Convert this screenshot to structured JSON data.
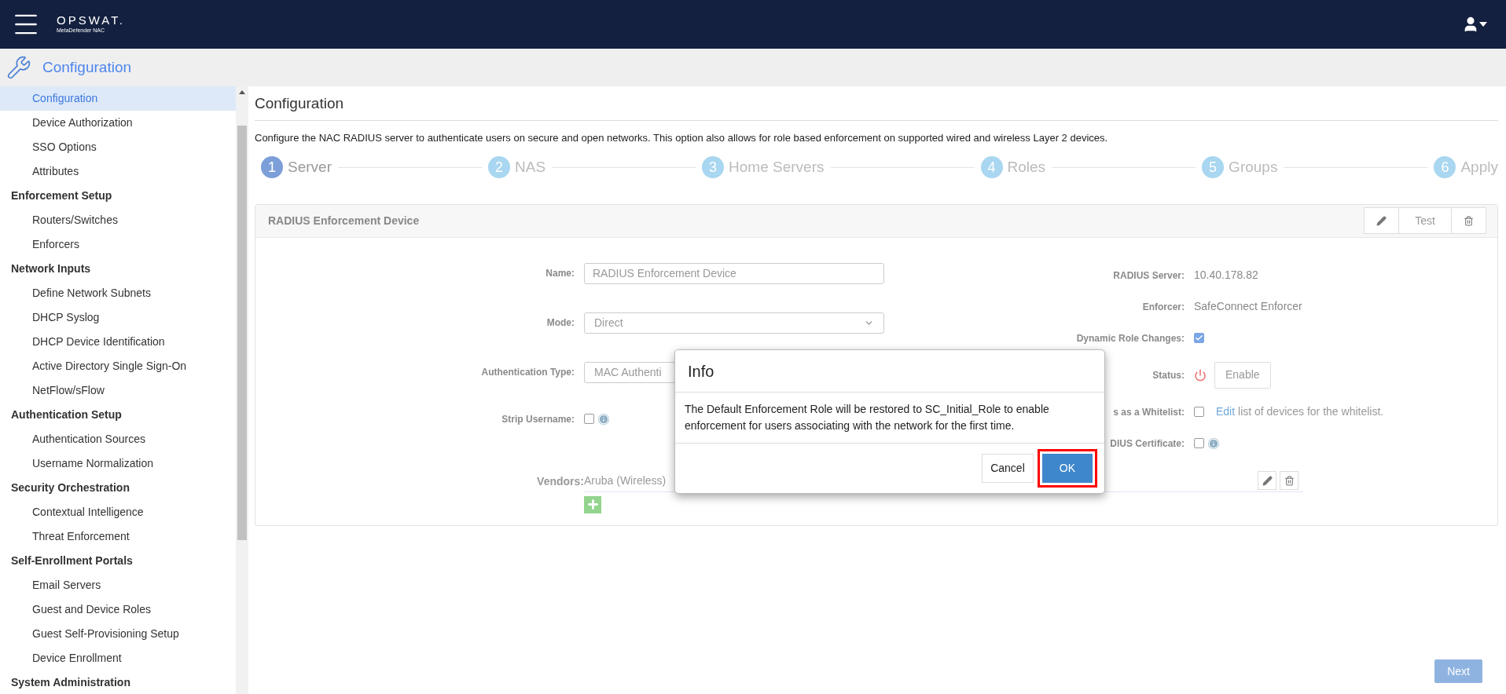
{
  "header": {
    "brand": "OPSWAT.",
    "product": "MetaDefender NAC"
  },
  "section_title": "Configuration",
  "sidebar": {
    "sections": [
      {
        "items": [
          {
            "label": "Configuration",
            "selected": true
          },
          {
            "label": "Device Authorization",
            "selected": false
          },
          {
            "label": "SSO Options",
            "selected": false
          },
          {
            "label": "Attributes",
            "selected": false
          }
        ]
      },
      {
        "heading": "Enforcement Setup",
        "items": [
          {
            "label": "Routers/Switches",
            "selected": false
          },
          {
            "label": "Enforcers",
            "selected": false
          }
        ]
      },
      {
        "heading": "Network Inputs",
        "items": [
          {
            "label": "Define Network Subnets",
            "selected": false
          },
          {
            "label": "DHCP Syslog",
            "selected": false
          },
          {
            "label": "DHCP Device Identification",
            "selected": false
          },
          {
            "label": "Active Directory Single Sign-On",
            "selected": false
          },
          {
            "label": "NetFlow/sFlow",
            "selected": false
          }
        ]
      },
      {
        "heading": "Authentication Setup",
        "items": [
          {
            "label": "Authentication Sources",
            "selected": false
          },
          {
            "label": "Username Normalization",
            "selected": false
          }
        ]
      },
      {
        "heading": "Security Orchestration",
        "items": [
          {
            "label": "Contextual Intelligence",
            "selected": false
          },
          {
            "label": "Threat Enforcement",
            "selected": false
          }
        ]
      },
      {
        "heading": "Self-Enrollment Portals",
        "items": [
          {
            "label": "Email Servers",
            "selected": false
          },
          {
            "label": "Guest and Device Roles",
            "selected": false
          },
          {
            "label": "Guest Self-Provisioning Setup",
            "selected": false
          },
          {
            "label": "Device Enrollment",
            "selected": false
          }
        ]
      },
      {
        "heading": "System Administration"
      }
    ]
  },
  "page": {
    "title": "Configuration",
    "description": "Configure the NAC RADIUS server to authenticate users on secure and open networks. This option also allows for role based enforcement on supported wired and wireless Layer 2 devices.",
    "steps": [
      {
        "number": "1",
        "label": "Server",
        "selected": true
      },
      {
        "number": "2",
        "label": "NAS",
        "selected": false
      },
      {
        "number": "3",
        "label": "Home Servers",
        "selected": false
      },
      {
        "number": "4",
        "label": "Roles",
        "selected": false
      },
      {
        "number": "5",
        "label": "Groups",
        "selected": false
      },
      {
        "number": "6",
        "label": "Apply",
        "selected": false
      }
    ],
    "card": {
      "title": "RADIUS Enforcement Device",
      "toolbar": [
        {
          "kind": "edit"
        },
        {
          "kind": "text",
          "label": "Test"
        },
        {
          "kind": "delete"
        }
      ],
      "left_fields": [
        {
          "kind": "text",
          "label": "Name:",
          "value": "RADIUS Enforcement Device"
        },
        {
          "kind": "select",
          "label": "Mode:",
          "value": "Direct",
          "arrow": true
        },
        {
          "kind": "select",
          "label": "Authentication Type:",
          "value": "MAC Authenti"
        },
        {
          "kind": "checkbox",
          "label": "Strip Username:",
          "checked": false,
          "info": true
        }
      ],
      "right_fields": [
        {
          "kind": "text",
          "label": "RADIUS Server:",
          "value": "10.40.178.82"
        },
        {
          "kind": "text",
          "label": "Enforcer:",
          "value": "SafeConnect Enforcer"
        },
        {
          "kind": "checkbox",
          "label": "Dynamic Role Changes:",
          "checked": true
        },
        {
          "kind": "status",
          "label": "Status:",
          "button": "Enable"
        },
        {
          "kind": "checkbox",
          "label": "s as a Whitelist:",
          "checked": false,
          "link": "Edit",
          "text": "list of devices for the whitelist."
        },
        {
          "kind": "checkbox",
          "label": "DIUS Certificate:",
          "checked": false,
          "info": true
        }
      ],
      "vendors": {
        "label": "Vendors:",
        "value": "Aruba (Wireless)"
      }
    },
    "next_button": "Next"
  },
  "dialog": {
    "title": "Info",
    "message": "The Default Enforcement Role will be restored to SC_Initial_Role to enable enforcement for users associating with the network for the first time.",
    "buttons": [
      {
        "label": "Cancel",
        "kind": "default",
        "highlighted": false
      },
      {
        "label": "OK",
        "kind": "primary",
        "highlighted": true
      }
    ]
  }
}
